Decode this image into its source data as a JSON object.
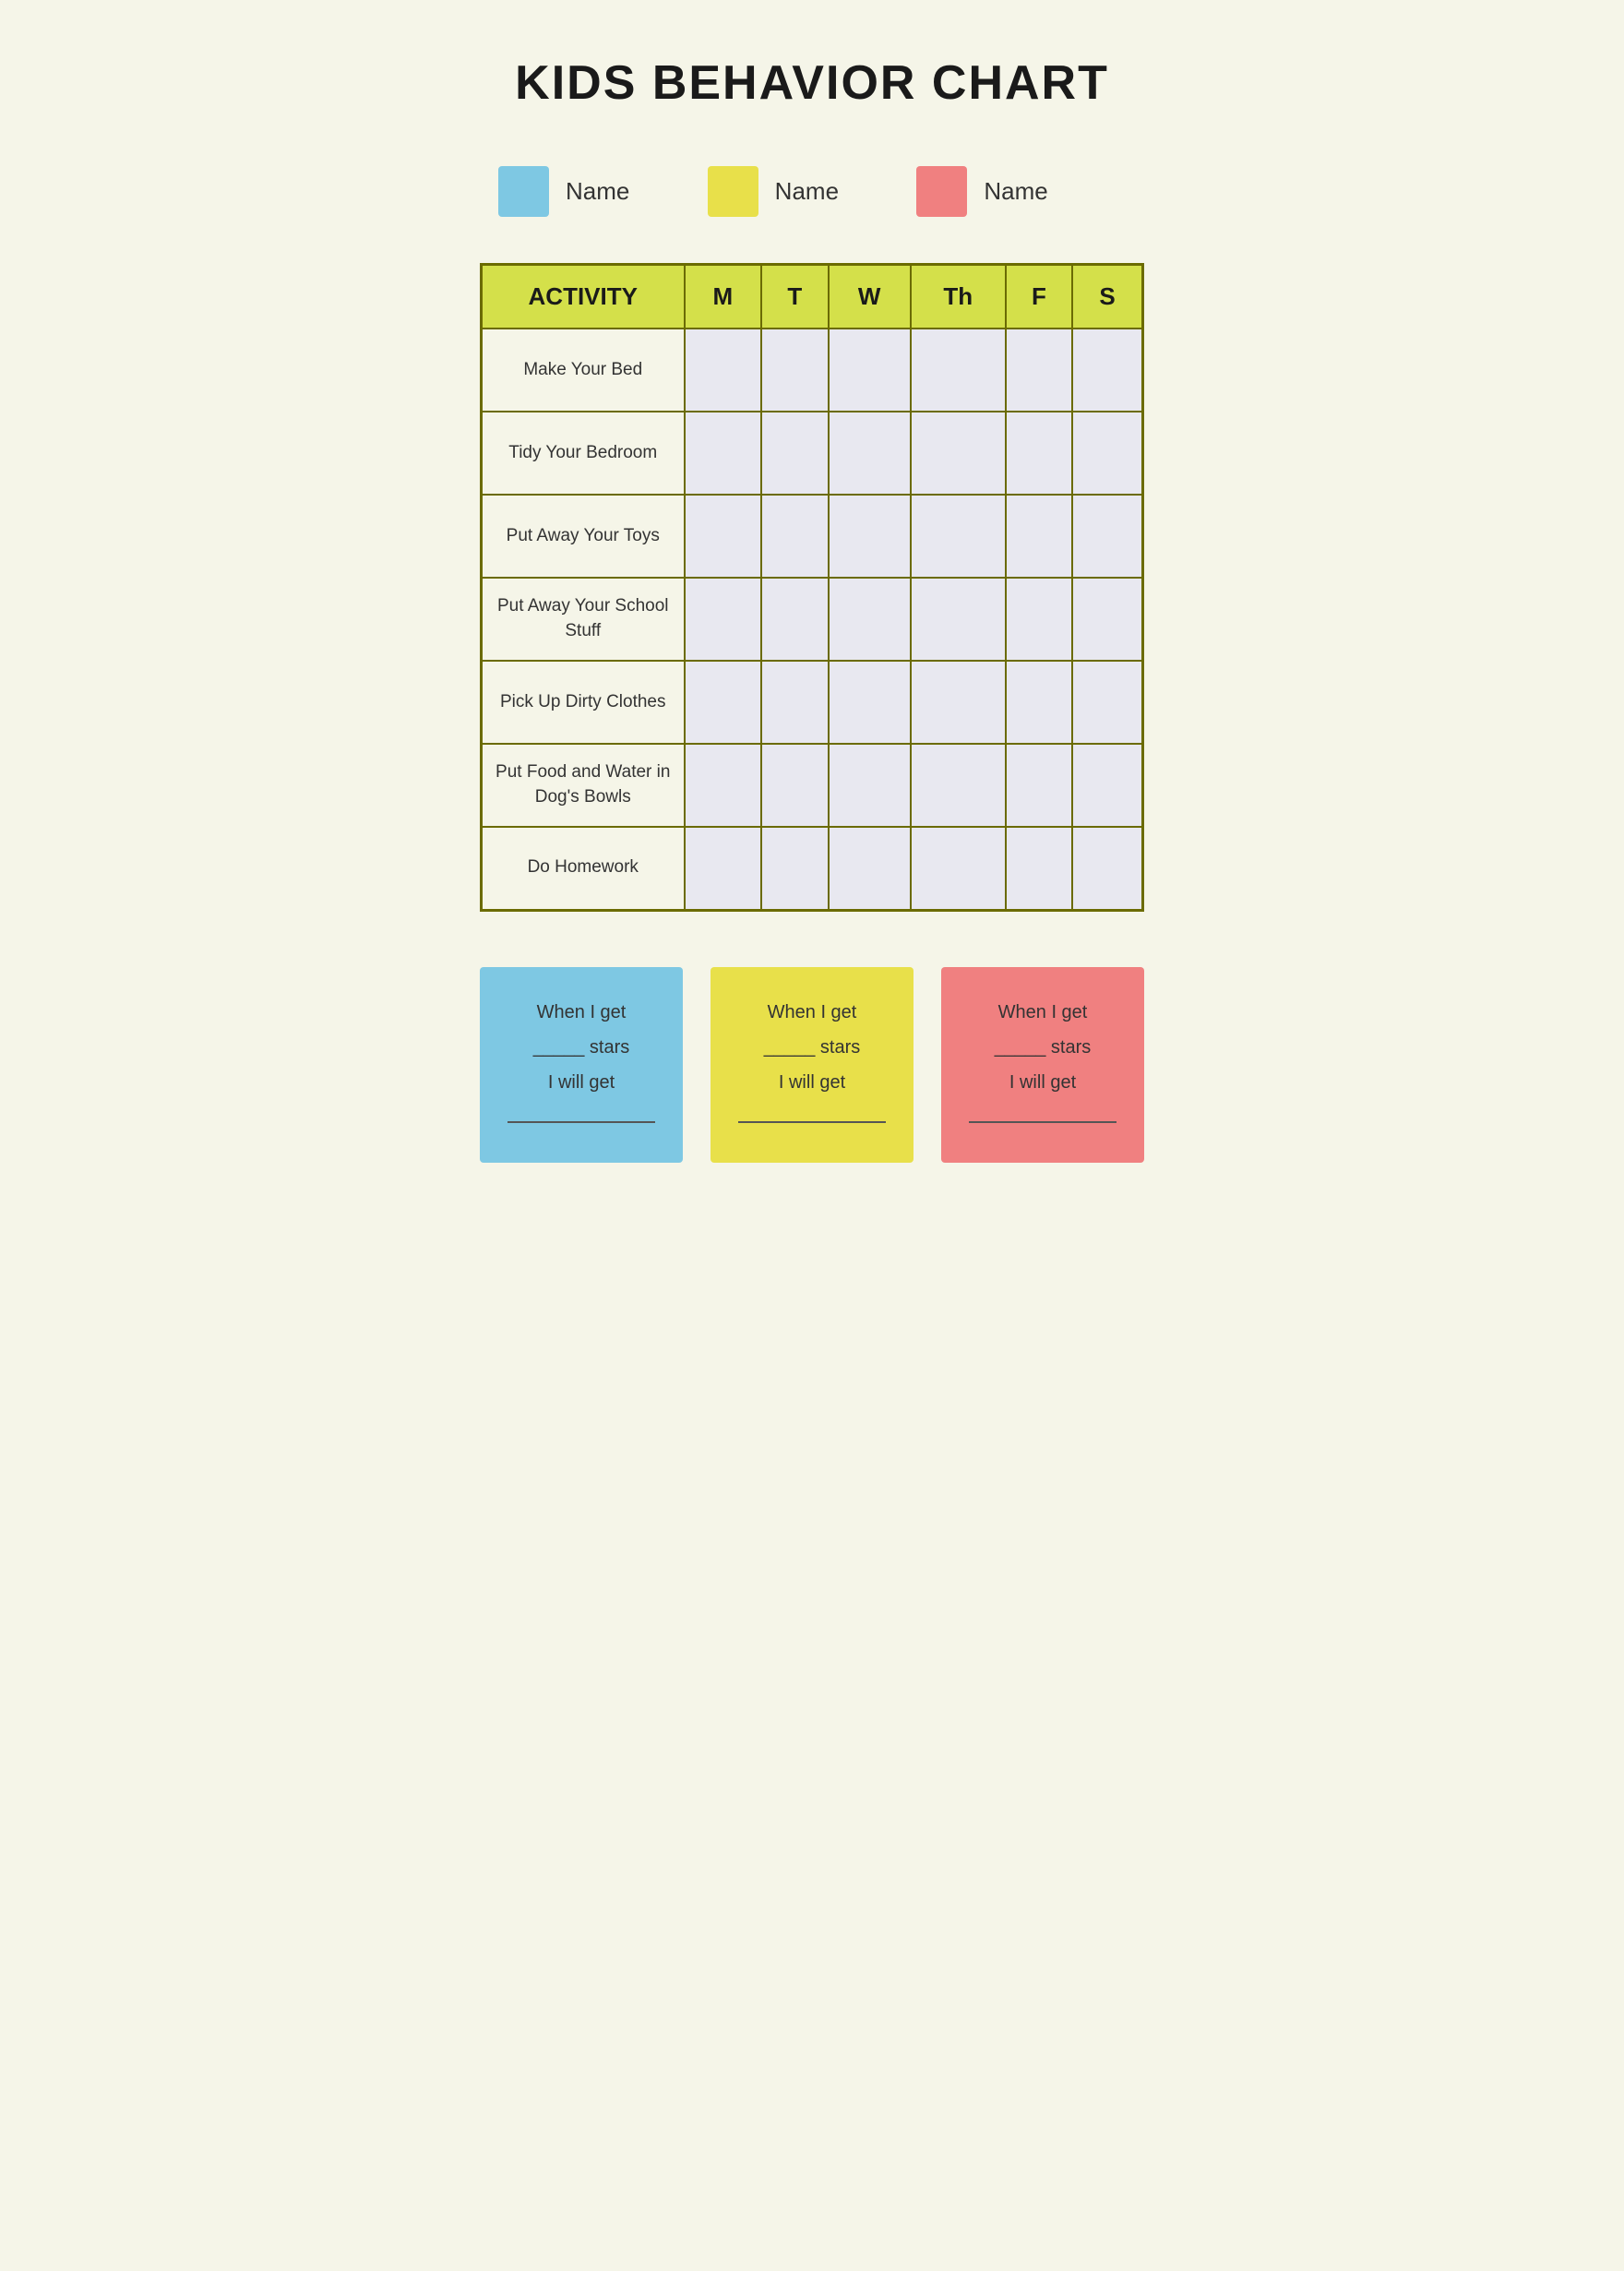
{
  "page": {
    "title": "KIDS BEHAVIOR CHART",
    "background_color": "#f5f5e8"
  },
  "legend": {
    "items": [
      {
        "id": "blue",
        "color": "#7ec8e3",
        "label": "Name"
      },
      {
        "id": "yellow",
        "color": "#e8e04a",
        "label": "Name"
      },
      {
        "id": "pink",
        "color": "#f08080",
        "label": "Name"
      }
    ]
  },
  "table": {
    "header": {
      "activity_label": "ACTIVITY",
      "days": [
        "M",
        "T",
        "W",
        "Th",
        "F",
        "S"
      ]
    },
    "rows": [
      {
        "activity": "Make Your Bed"
      },
      {
        "activity": "Tidy Your Bedroom"
      },
      {
        "activity": "Put Away Your Toys"
      },
      {
        "activity": "Put Away Your School Stuff"
      },
      {
        "activity": "Pick Up Dirty Clothes"
      },
      {
        "activity": "Put Food and Water in Dog's Bowls"
      },
      {
        "activity": "Do Homework"
      }
    ]
  },
  "rewards": [
    {
      "id": "blue",
      "color": "#7ec8e3",
      "line1": "When I get",
      "line2": "_____ stars",
      "line3": "I will get",
      "line4": "_______________"
    },
    {
      "id": "yellow",
      "color": "#e8e04a",
      "line1": "When I get",
      "line2": "_____ stars",
      "line3": "I will get",
      "line4": "_______________"
    },
    {
      "id": "pink",
      "color": "#f08080",
      "line1": "When I get",
      "line2": "_____ stars",
      "line3": "I will get",
      "line4": "_______________"
    }
  ]
}
